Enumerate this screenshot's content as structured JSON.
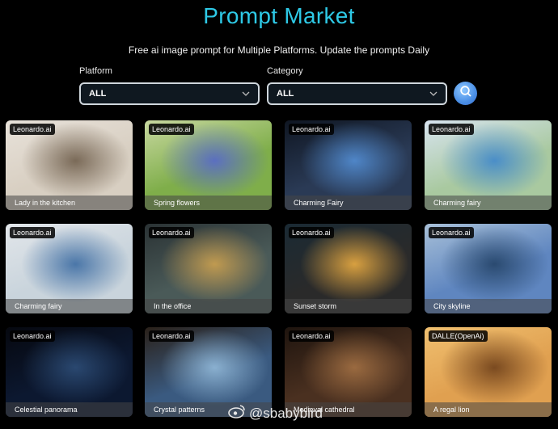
{
  "header": {
    "title": "Prompt Market",
    "subtitle": "Free ai image prompt for Multiple Platforms. Update the prompts Daily"
  },
  "filters": {
    "platform_label": "Platform",
    "platform_value": "ALL",
    "category_label": "Category",
    "category_value": "ALL"
  },
  "cards": [
    {
      "badge": "Leonardo.ai",
      "caption": "Lady in the kitchen",
      "colors": [
        "#d8cfc2",
        "#7a6a58",
        "#e8e2da"
      ]
    },
    {
      "badge": "Leonardo.ai",
      "caption": "Spring flowers",
      "colors": [
        "#7fae4a",
        "#5b6fc0",
        "#c8d8a0"
      ]
    },
    {
      "badge": "Leonardo.ai",
      "caption": "Charming Fairy",
      "colors": [
        "#2a3a55",
        "#4f86c8",
        "#0f1622"
      ]
    },
    {
      "badge": "Leonardo.ai",
      "caption": "Charming fairy",
      "colors": [
        "#a9c9a0",
        "#4a8ec8",
        "#d8e4f0"
      ]
    },
    {
      "badge": "Leonardo.ai",
      "caption": "Charming fairy",
      "colors": [
        "#c9d4dc",
        "#4a76a8",
        "#e2e6ea"
      ]
    },
    {
      "badge": "Leonardo.ai",
      "caption": "In the office",
      "colors": [
        "#4a5a58",
        "#c09a50",
        "#2a3234"
      ]
    },
    {
      "badge": "Leonardo.ai",
      "caption": "Sunset storm",
      "colors": [
        "#2a2a2a",
        "#d8a040",
        "#1a2a34"
      ]
    },
    {
      "badge": "Leonardo.ai",
      "caption": "City skyline",
      "colors": [
        "#5f86c0",
        "#2a4a70",
        "#a8c0d8"
      ]
    },
    {
      "badge": "Leonardo.ai",
      "caption": "Celestial panorama",
      "colors": [
        "#0c1830",
        "#2a4870",
        "#06080f"
      ]
    },
    {
      "badge": "Leonardo.ai",
      "caption": "Crystal patterns",
      "colors": [
        "#3a5a80",
        "#8ab0d0",
        "#2a2018"
      ]
    },
    {
      "badge": "Leonardo.ai",
      "caption": "Medieval cathedral",
      "colors": [
        "#4a3020",
        "#9a6a40",
        "#1e140e"
      ]
    },
    {
      "badge": "DALLE(OpenAi)",
      "caption": "A regal lion",
      "colors": [
        "#e0a050",
        "#7a4a20",
        "#f0c070"
      ]
    }
  ],
  "watermark": {
    "icon": "weibo-icon",
    "text": "@sbabybird"
  }
}
